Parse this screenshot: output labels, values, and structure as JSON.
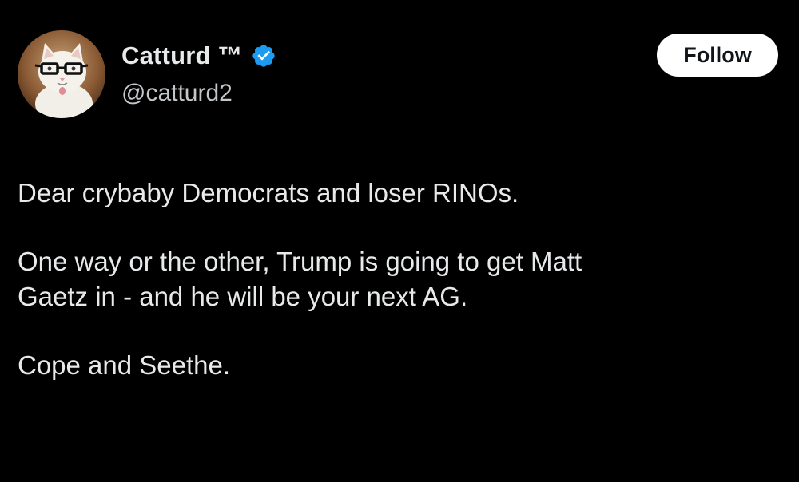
{
  "author": {
    "display_name": "Catturd ™",
    "handle": "@catturd2",
    "verified": true,
    "avatar_icon": "cat-with-glasses-avatar"
  },
  "follow_button": {
    "label": "Follow"
  },
  "tweet": {
    "paragraphs": [
      "Dear crybaby Democrats and loser RINOs.",
      "One way or the other, Trump is going to get Matt\nGaetz in - and he will be your next AG.",
      "Cope and Seethe."
    ]
  },
  "colors": {
    "background": "#000000",
    "text": "#e7e9ea",
    "handle": "#c4c7ca",
    "verified_badge": "#1d9bf0",
    "button_bg": "#ffffff",
    "button_text": "#0f1419"
  }
}
